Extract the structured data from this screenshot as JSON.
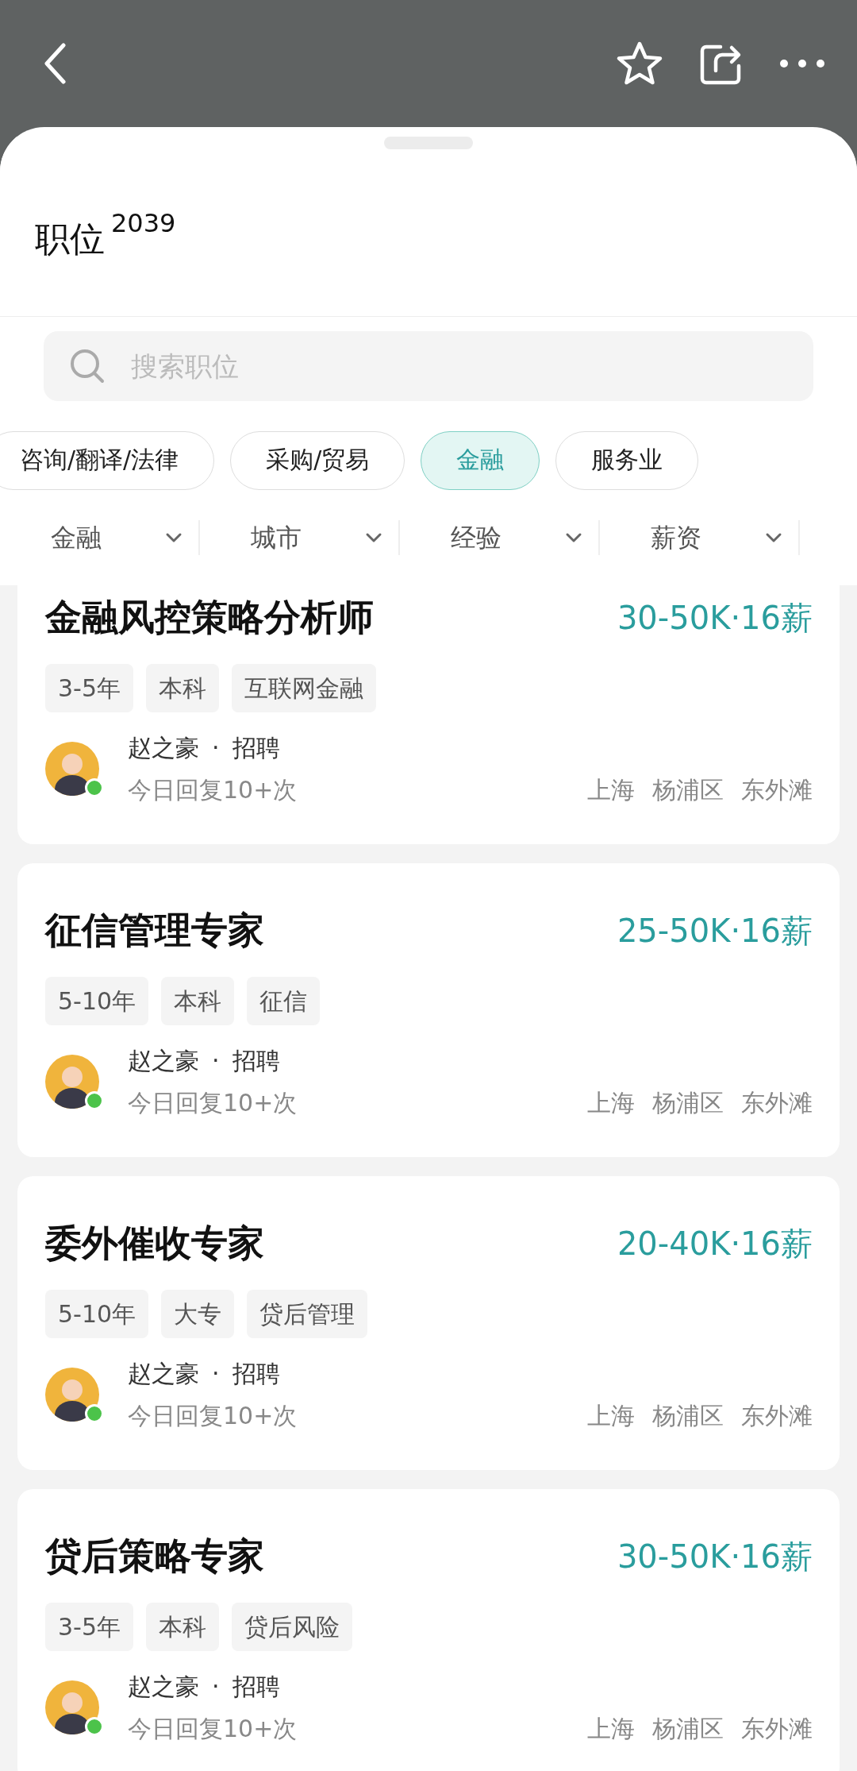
{
  "header": {
    "title": "职位",
    "count": "2039"
  },
  "search": {
    "placeholder": "搜索职位"
  },
  "categories": [
    {
      "label": "咨询/翻译/法律",
      "selected": false
    },
    {
      "label": "采购/贸易",
      "selected": false
    },
    {
      "label": "金融",
      "selected": true
    },
    {
      "label": "服务业",
      "selected": false
    }
  ],
  "filters": [
    {
      "label": "金融"
    },
    {
      "label": "城市"
    },
    {
      "label": "经验"
    },
    {
      "label": "薪资"
    }
  ],
  "jobs": [
    {
      "title": "金融风控策略分析师",
      "salary": "30-50K·16薪",
      "tags": [
        "3-5年",
        "本科",
        "互联网金融"
      ],
      "recruiter": "赵之豪",
      "separator": "·",
      "role": "招聘",
      "online": true,
      "reply": "今日回复10+次",
      "location": [
        "上海",
        "杨浦区",
        "东外滩"
      ]
    },
    {
      "title": "征信管理专家",
      "salary": "25-50K·16薪",
      "tags": [
        "5-10年",
        "本科",
        "征信"
      ],
      "recruiter": "赵之豪",
      "separator": "·",
      "role": "招聘",
      "online": true,
      "reply": "今日回复10+次",
      "location": [
        "上海",
        "杨浦区",
        "东外滩"
      ]
    },
    {
      "title": "委外催收专家",
      "salary": "20-40K·16薪",
      "tags": [
        "5-10年",
        "大专",
        "贷后管理"
      ],
      "recruiter": "赵之豪",
      "separator": "·",
      "role": "招聘",
      "online": true,
      "reply": "今日回复10+次",
      "location": [
        "上海",
        "杨浦区",
        "东外滩"
      ]
    },
    {
      "title": "贷后策略专家",
      "salary": "30-50K·16薪",
      "tags": [
        "3-5年",
        "本科",
        "贷后风险"
      ],
      "recruiter": "赵之豪",
      "separator": "·",
      "role": "招聘",
      "online": true,
      "reply": "今日回复10+次",
      "location": [
        "上海",
        "杨浦区",
        "东外滩"
      ]
    }
  ]
}
